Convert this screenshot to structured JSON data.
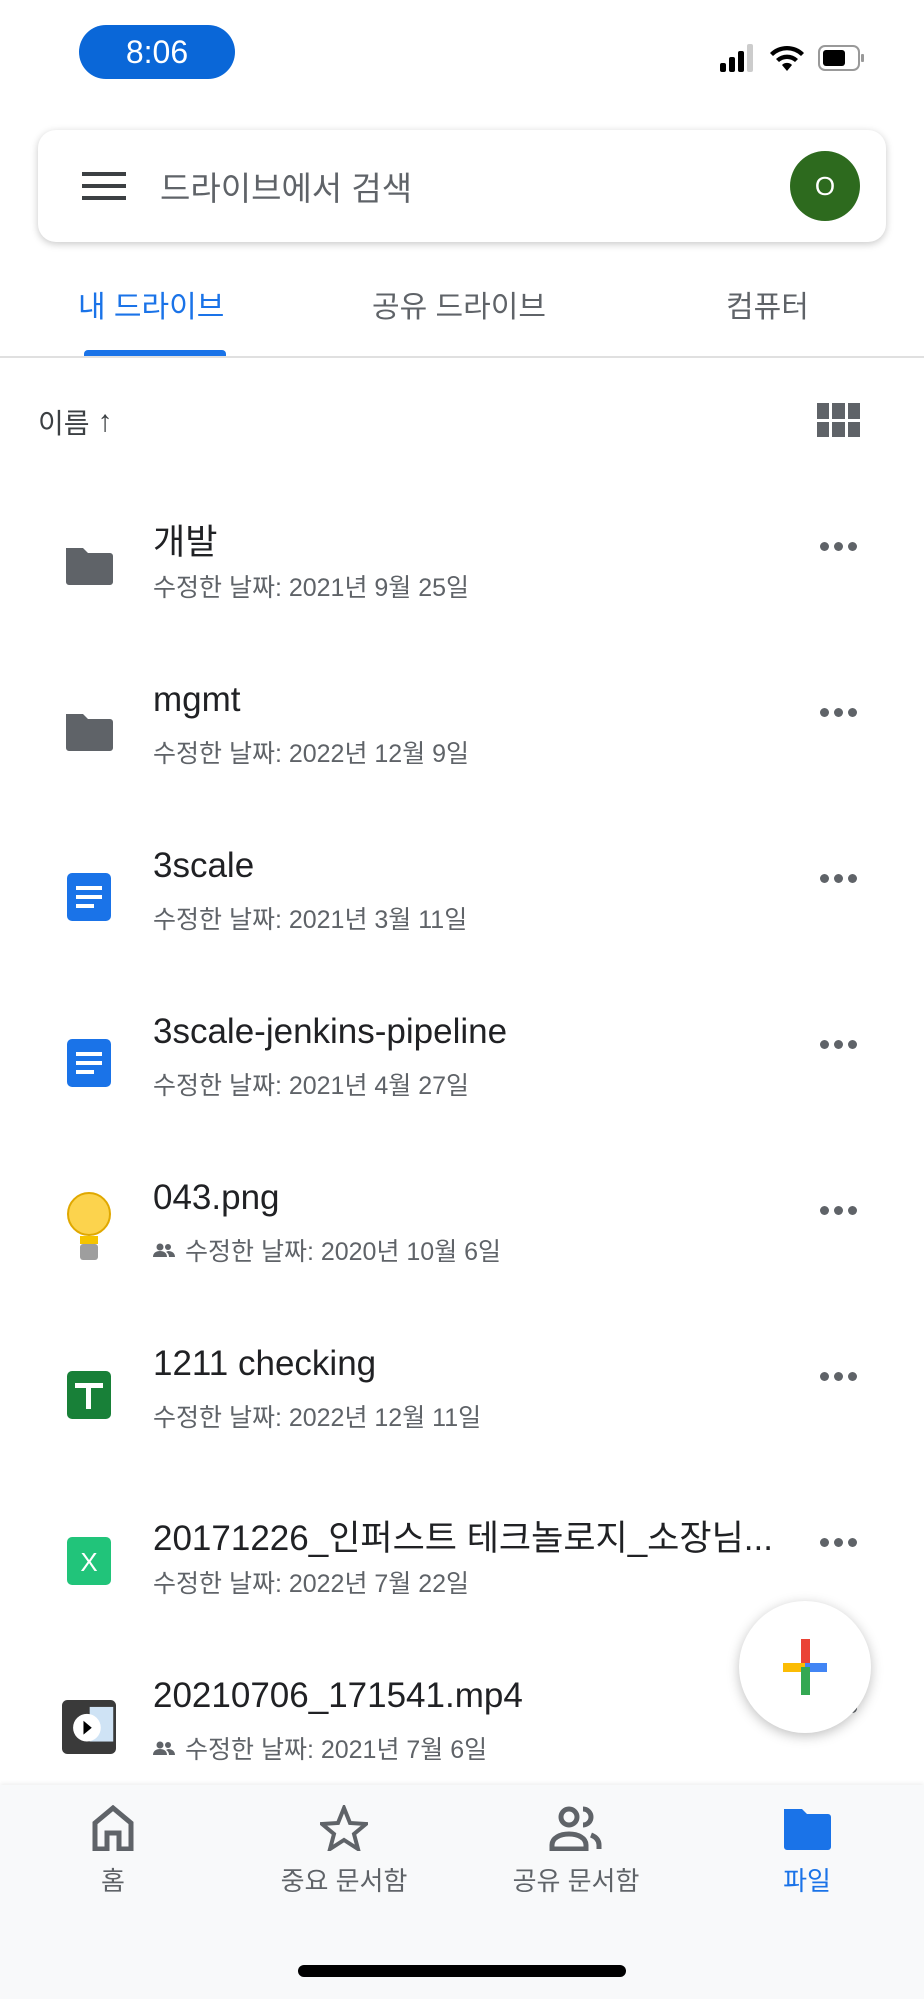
{
  "status_bar": {
    "time": "8:06"
  },
  "search": {
    "placeholder": "드라이브에서 검색",
    "avatar_letter": "O"
  },
  "tabs": [
    {
      "label": "내 드라이브",
      "active": true
    },
    {
      "label": "공유 드라이브"
    },
    {
      "label": "컴퓨터"
    }
  ],
  "sort": {
    "label": "이름",
    "direction": "ascending"
  },
  "files": [
    {
      "name": "개발",
      "modified": "수정한 날짜: 2021년 9월 25일",
      "type": "folder",
      "shared": false
    },
    {
      "name": "mgmt",
      "modified": "수정한 날짜: 2022년 12월 9일",
      "type": "folder",
      "shared": false
    },
    {
      "name": "3scale",
      "modified": "수정한 날짜: 2021년 3월 11일",
      "type": "doc",
      "shared": false
    },
    {
      "name": "3scale-jenkins-pipeline",
      "modified": "수정한 날짜: 2021년 4월 27일",
      "type": "doc",
      "shared": false
    },
    {
      "name": "043.png",
      "modified": "수정한 날짜: 2020년 10월 6일",
      "type": "image",
      "shared": true
    },
    {
      "name": "1211 checking",
      "modified": "수정한 날짜: 2022년 12월 11일",
      "type": "sheet",
      "shared": false
    },
    {
      "name": "20171226_인퍼스트 테크놀로지_소장님...",
      "modified": "수정한 날짜: 2022년 7월 22일",
      "type": "excel",
      "shared": false
    },
    {
      "name": "20210706_171541.mp4",
      "modified": "수정한 날짜: 2021년 7월 6일",
      "type": "video",
      "shared": true
    }
  ],
  "bottom_nav": [
    {
      "label": "홈"
    },
    {
      "label": "중요 문서함"
    },
    {
      "label": "공유 문서함"
    },
    {
      "label": "파일",
      "active": true
    }
  ],
  "colors": {
    "accent": "#1a73e8",
    "avatar": "#2d6a1e"
  }
}
